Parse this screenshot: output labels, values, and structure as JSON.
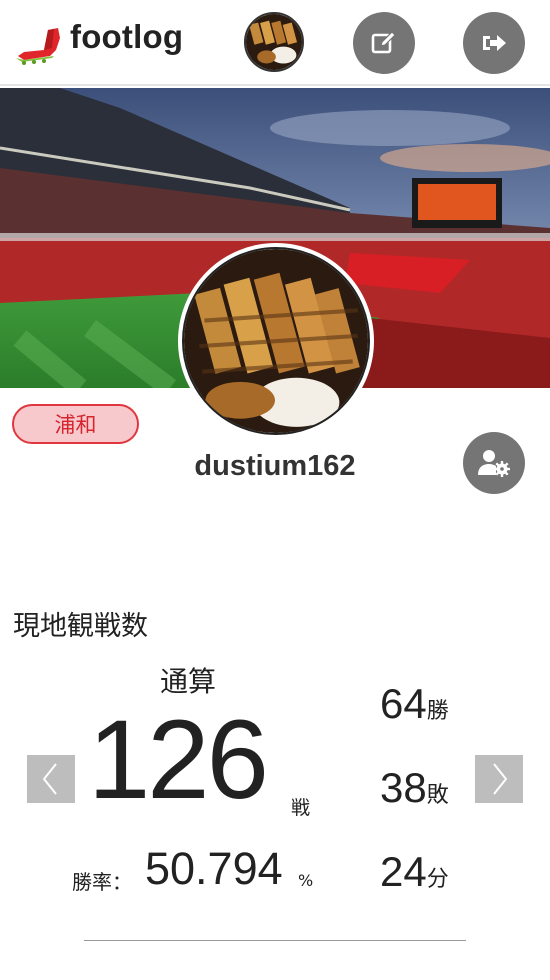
{
  "header": {
    "app_name": "footlog",
    "logo_icon": "football-boot-icon",
    "edit_icon": "edit-icon",
    "logout_icon": "logout-icon"
  },
  "profile": {
    "team": "浦和",
    "username": "dustium162",
    "settings_icon": "user-settings-icon"
  },
  "stats": {
    "section_title": "現地観戦数",
    "period": "通算",
    "total": "126",
    "total_unit": "戦",
    "winrate_label": "勝率：",
    "winrate": "50.794",
    "winrate_unit": "%",
    "wins": "64",
    "wins_unit": "勝",
    "losses": "38",
    "losses_unit": "敗",
    "draws": "24",
    "draws_unit": "分"
  },
  "colors": {
    "badge_bg": "#f7c9cd",
    "badge_border": "#e0373f",
    "button_gray": "#757575",
    "nav_gray": "#bdbdbd"
  }
}
